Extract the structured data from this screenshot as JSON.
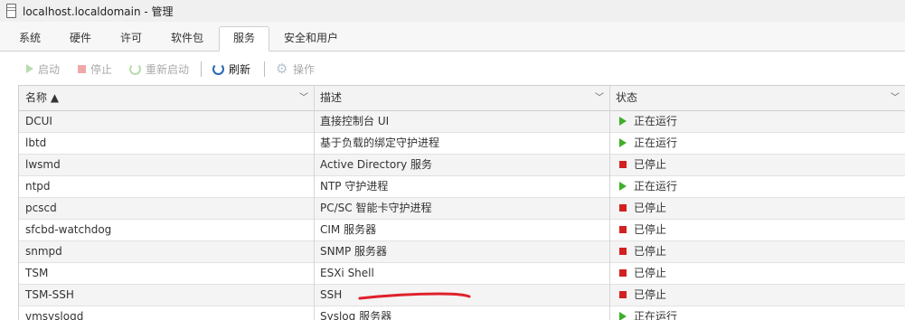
{
  "window": {
    "title": "localhost.localdomain - 管理"
  },
  "tabs": [
    {
      "label": "系统"
    },
    {
      "label": "硬件"
    },
    {
      "label": "许可"
    },
    {
      "label": "软件包"
    },
    {
      "label": "服务",
      "active": true
    },
    {
      "label": "安全和用户"
    }
  ],
  "toolbar": {
    "start": "启动",
    "stop": "停止",
    "restart": "重新启动",
    "refresh": "刷新",
    "actions": "操作"
  },
  "table": {
    "columns": [
      "名称 ▲",
      "描述",
      "状态"
    ],
    "rows": [
      {
        "name": "DCUI",
        "desc": "直接控制台 UI",
        "status": "正在运行",
        "running": true
      },
      {
        "name": "lbtd",
        "desc": "基于负载的绑定守护进程",
        "status": "正在运行",
        "running": true
      },
      {
        "name": "lwsmd",
        "desc": "Active Directory 服务",
        "status": "已停止",
        "running": false
      },
      {
        "name": "ntpd",
        "desc": "NTP 守护进程",
        "status": "正在运行",
        "running": true
      },
      {
        "name": "pcscd",
        "desc": "PC/SC 智能卡守护进程",
        "status": "已停止",
        "running": false
      },
      {
        "name": "sfcbd-watchdog",
        "desc": "CIM 服务器",
        "status": "已停止",
        "running": false
      },
      {
        "name": "snmpd",
        "desc": "SNMP 服务器",
        "status": "已停止",
        "running": false
      },
      {
        "name": "TSM",
        "desc": "ESXi Shell",
        "status": "已停止",
        "running": false
      },
      {
        "name": "TSM-SSH",
        "desc": "SSH",
        "status": "已停止",
        "running": false
      },
      {
        "name": "vmsyslogd",
        "desc": "Syslog 服务器",
        "status": "正在运行",
        "running": true
      }
    ]
  },
  "colors": {
    "running": "#3fae2a",
    "stopped": "#d32020",
    "annotation": "#e0202a"
  }
}
